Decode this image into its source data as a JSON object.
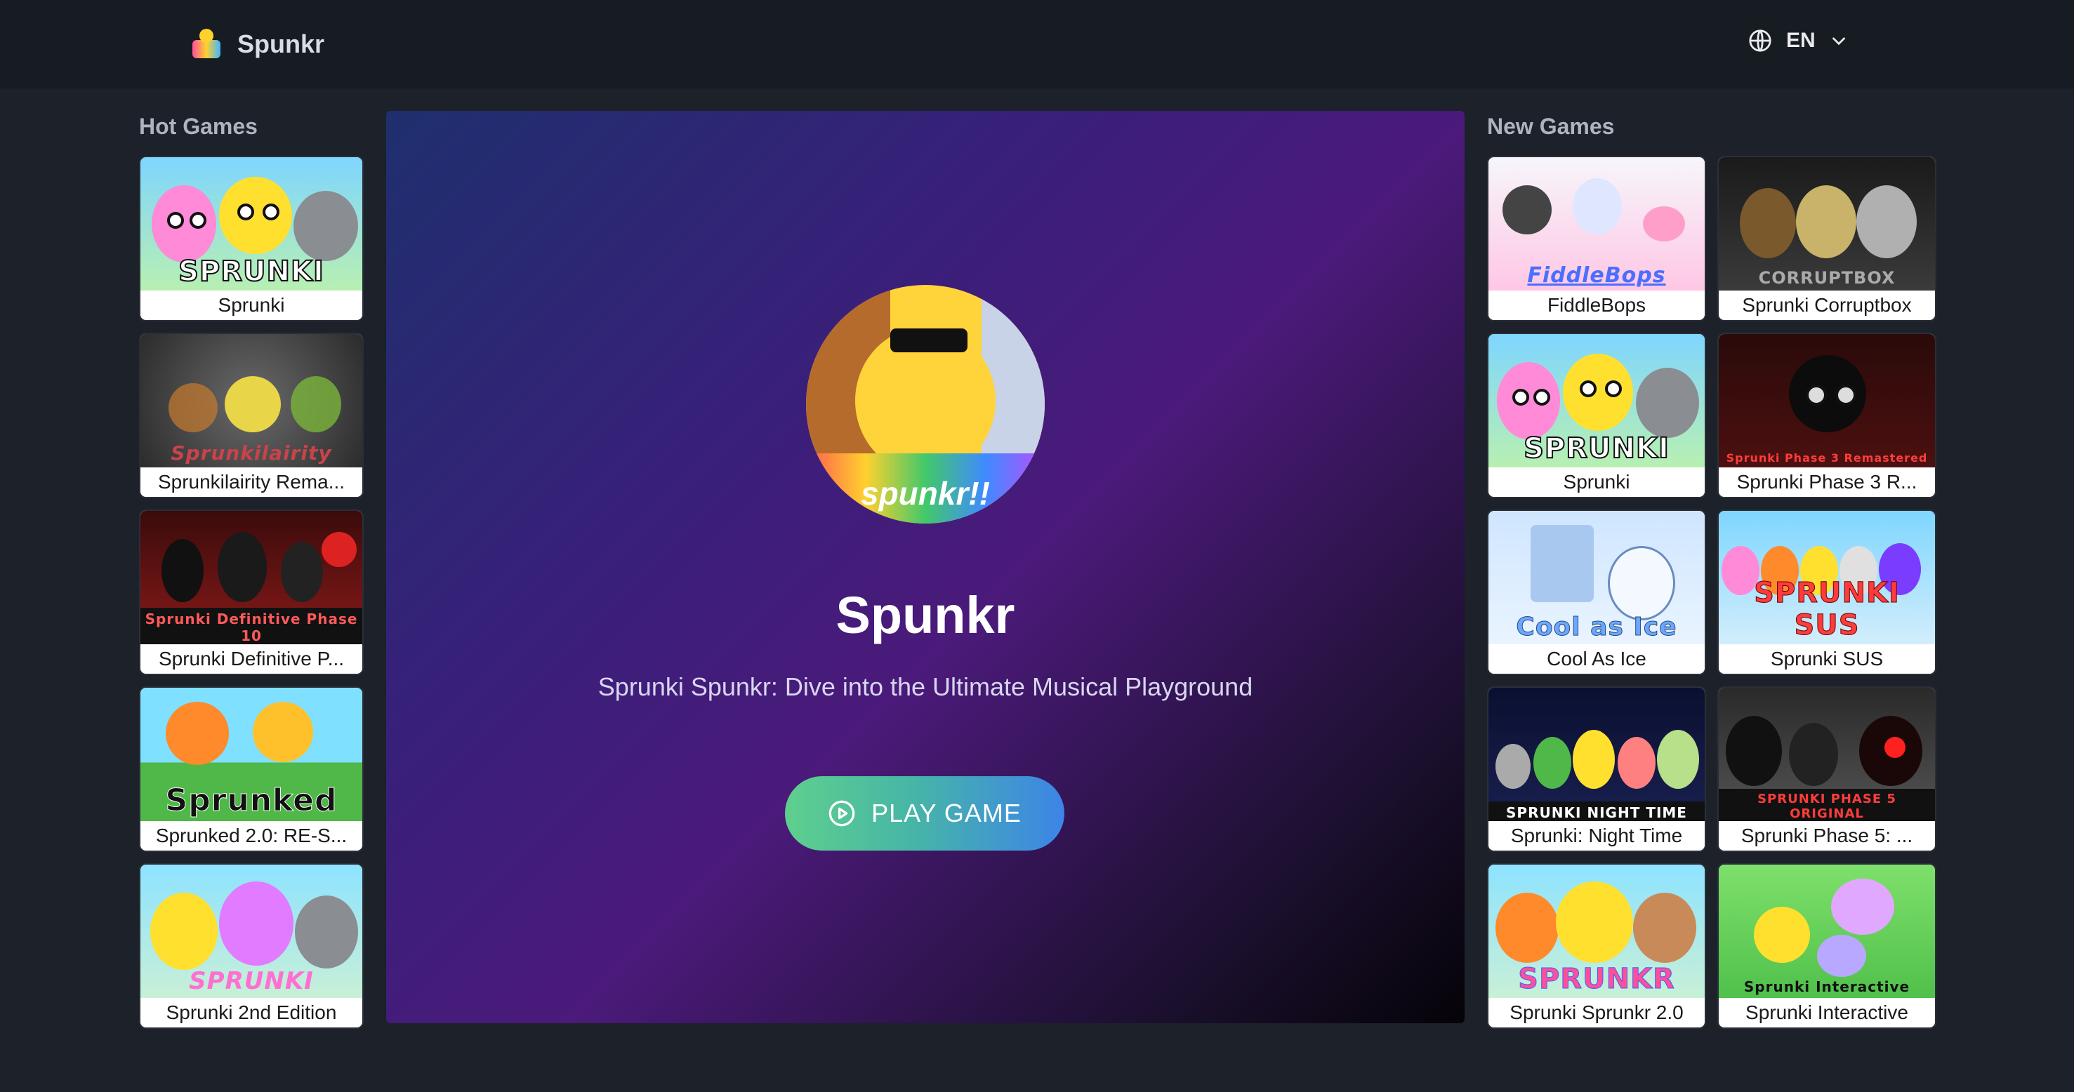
{
  "header": {
    "brand": "Spunkr",
    "language": "EN"
  },
  "hot_games": {
    "title": "Hot Games",
    "items": [
      {
        "label": "Sprunki",
        "caption": "SPRUNKI"
      },
      {
        "label": "Sprunkilairity Rema...",
        "caption": "Sprunkilairity"
      },
      {
        "label": "Sprunki Definitive P...",
        "caption": "Sprunki Definitive Phase 10"
      },
      {
        "label": "Sprunked 2.0: RE-S...",
        "caption": "Sprunked"
      },
      {
        "label": "Sprunki 2nd Edition",
        "caption": "SPRUNKI"
      }
    ]
  },
  "hero": {
    "title": "Spunkr",
    "subtitle": "Sprunki Spunkr: Dive into the Ultimate Musical Playground",
    "play_label": "PLAY GAME",
    "avatar_caption": "spunkr!!"
  },
  "new_games": {
    "title": "New Games",
    "items": [
      {
        "label": "FiddleBops",
        "caption": "FiddleBops"
      },
      {
        "label": "Sprunki Corruptbox",
        "caption": "CORRUPTBOX"
      },
      {
        "label": "Sprunki",
        "caption": "SPRUNKI"
      },
      {
        "label": "Sprunki Phase 3 R...",
        "caption": "Sprunki Phase 3 Remastered"
      },
      {
        "label": "Cool As Ice",
        "caption": "Cool as Ice"
      },
      {
        "label": "Sprunki SUS",
        "caption": "SPRUNKI SUS"
      },
      {
        "label": "Sprunki: Night Time",
        "caption": "SPRUNKI NIGHT TIME"
      },
      {
        "label": "Sprunki Phase 5: ...",
        "caption": "SPRUNKI PHASE 5 ORIGINAL"
      },
      {
        "label": "Sprunki Sprunkr 2.0",
        "caption": "SPRUNKR"
      },
      {
        "label": "Sprunki Interactive",
        "caption": "Sprunki Interactive"
      }
    ]
  },
  "colors": {
    "background": "#1c212a",
    "topbar": "#171b22",
    "play_start": "#5fcf8e",
    "play_end": "#3d84e8"
  }
}
